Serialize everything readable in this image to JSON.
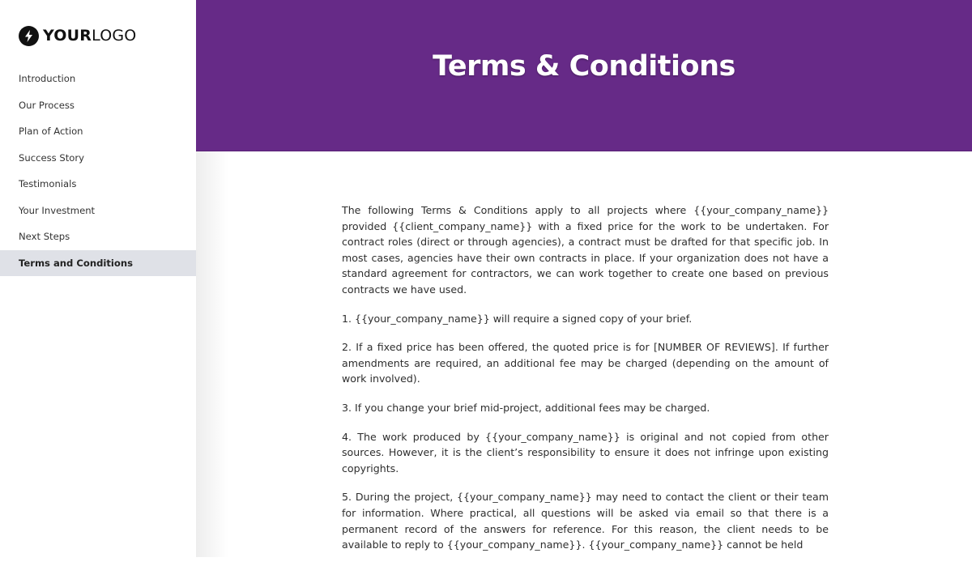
{
  "logo": {
    "icon": "lightning-bolt-icon",
    "text_bold": "YOUR",
    "text_light": "LOGO"
  },
  "sidebar": {
    "items": [
      {
        "label": "Introduction",
        "active": false
      },
      {
        "label": "Our Process",
        "active": false
      },
      {
        "label": "Plan of Action",
        "active": false
      },
      {
        "label": "Success Story",
        "active": false
      },
      {
        "label": "Testimonials",
        "active": false
      },
      {
        "label": "Your Investment",
        "active": false
      },
      {
        "label": "Next Steps",
        "active": false
      },
      {
        "label": "Terms and Conditions",
        "active": true
      }
    ]
  },
  "banner": {
    "title": "Terms & Conditions",
    "color": "#662a87"
  },
  "content": {
    "paragraphs": [
      "The following Terms & Conditions apply to all projects where {{your_company_name}} provided {{client_company_name}}  with a fixed price for the work to be undertaken. For contract roles (direct or through agencies), a contract must be drafted for that specific job. In most cases, agencies have their own contracts in place. If your organization does not have a standard agreement for contractors, we can work together to create one based on previous contracts we have used.",
      "1. {{your_company_name}} will require a signed copy of your brief.",
      "2. If a fixed price has been offered, the quoted price is for [NUMBER OF REVIEWS]. If further amendments are required, an additional fee may be charged (depending on the amount of work involved).",
      "3. If you change your brief mid-project, additional fees may be charged.",
      "4. The work produced by {{your_company_name}} is original and not copied from other sources. However, it is the client’s responsibility to ensure it does not infringe upon existing copyrights.",
      "5. During the project, {{your_company_name}} may need to contact the client or their team for information. Where practical, all questions will be asked via email so that there is a permanent record of the answers for reference. For this reason, the client needs to be available to reply to {{your_company_name}}. {{your_company_name}} cannot be held"
    ]
  }
}
